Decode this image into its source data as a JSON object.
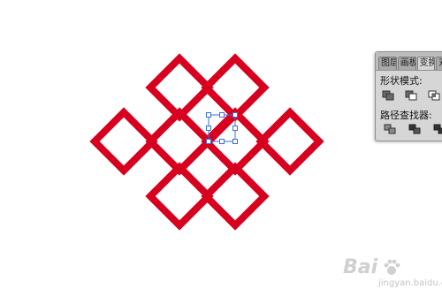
{
  "artwork": {
    "shape_color": "#d8001f",
    "selection_color": "#3a6fd8"
  },
  "panel": {
    "tabs": [
      "图层",
      "画板",
      "变换",
      "对齐"
    ],
    "shape_modes_label": "形状模式:",
    "pathfinders_label": "路径查找器:",
    "icons": [
      "unite-icon",
      "minus-front-icon",
      "intersect-icon",
      "divide-icon",
      "trim-icon",
      "merge-icon"
    ]
  },
  "watermark": {
    "brand": "Bai",
    "site": "jingyan.baidu.com"
  }
}
